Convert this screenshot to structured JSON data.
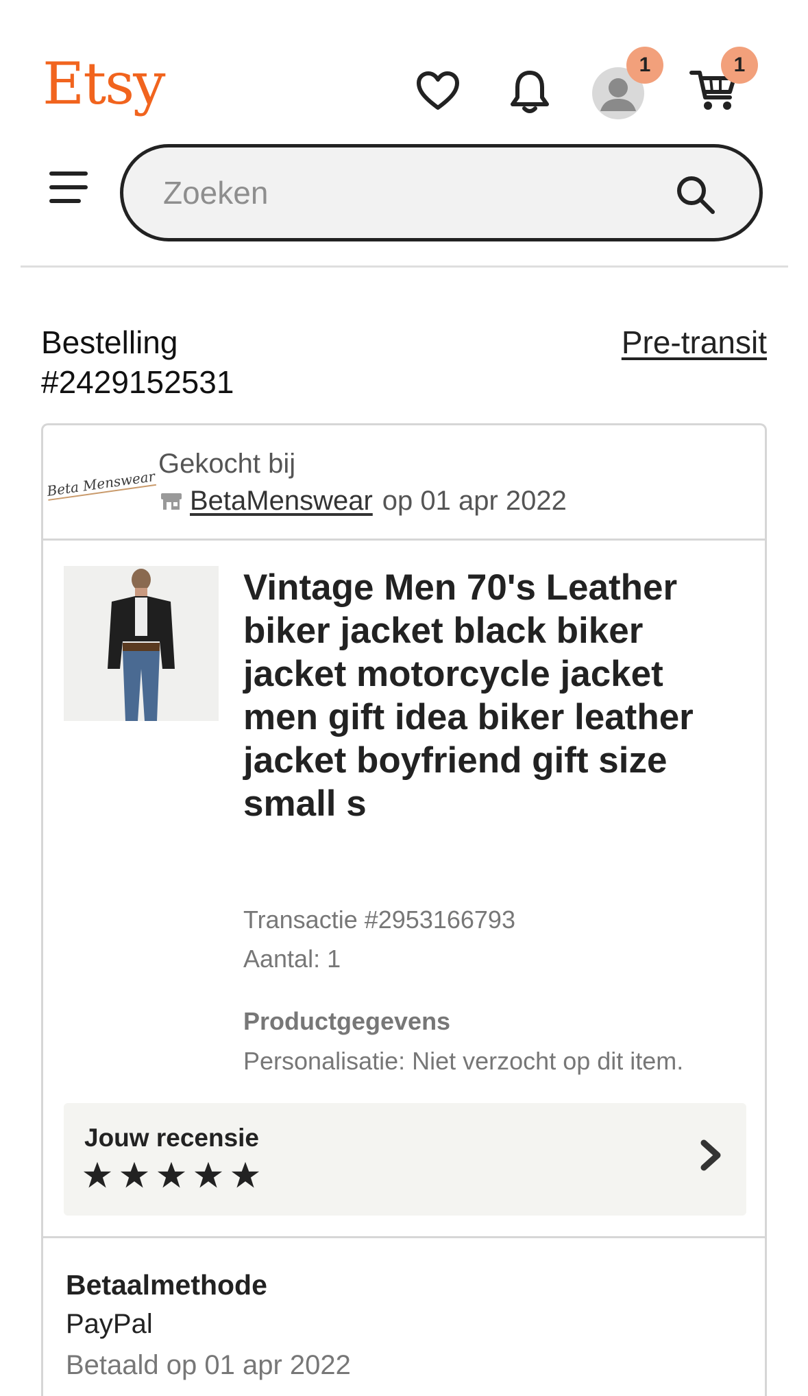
{
  "header": {
    "logo": "Etsy",
    "account_badge": "1",
    "cart_badge": "1",
    "icons": [
      "heart-icon",
      "bell-icon",
      "user-icon",
      "cart-icon",
      "menu-icon",
      "search-icon"
    ]
  },
  "search": {
    "placeholder": "Zoeken",
    "value": ""
  },
  "order": {
    "label": "Bestelling",
    "number": "#2429152531",
    "status_link": "Pre-transit"
  },
  "shop": {
    "logo_text": "Beta Menswear",
    "bought_label": "Gekocht bij",
    "name": "BetaMenswear",
    "date_text": "op 01 apr 2022"
  },
  "item": {
    "title": "Vintage Men 70's Leather biker jacket black biker jacket motorcycle jacket men gift idea biker leather jacket boyfriend gift size small s",
    "transaction": "Transactie #2953166793",
    "quantity": "Aantal: 1",
    "details_heading": "Productgegevens",
    "personalisation": "Personalisatie: Niet verzocht op dit item."
  },
  "review": {
    "label": "Jouw recensie",
    "rating": 5,
    "max_rating": 5
  },
  "payment": {
    "heading": "Betaalmethode",
    "method": "PayPal",
    "paid_date": "Betaald op 01 apr 2022"
  },
  "colors": {
    "brand": "#f1641e",
    "badge": "#f2a07b",
    "text": "#222222",
    "muted": "#777777",
    "review_bg": "#f4f4f1"
  }
}
